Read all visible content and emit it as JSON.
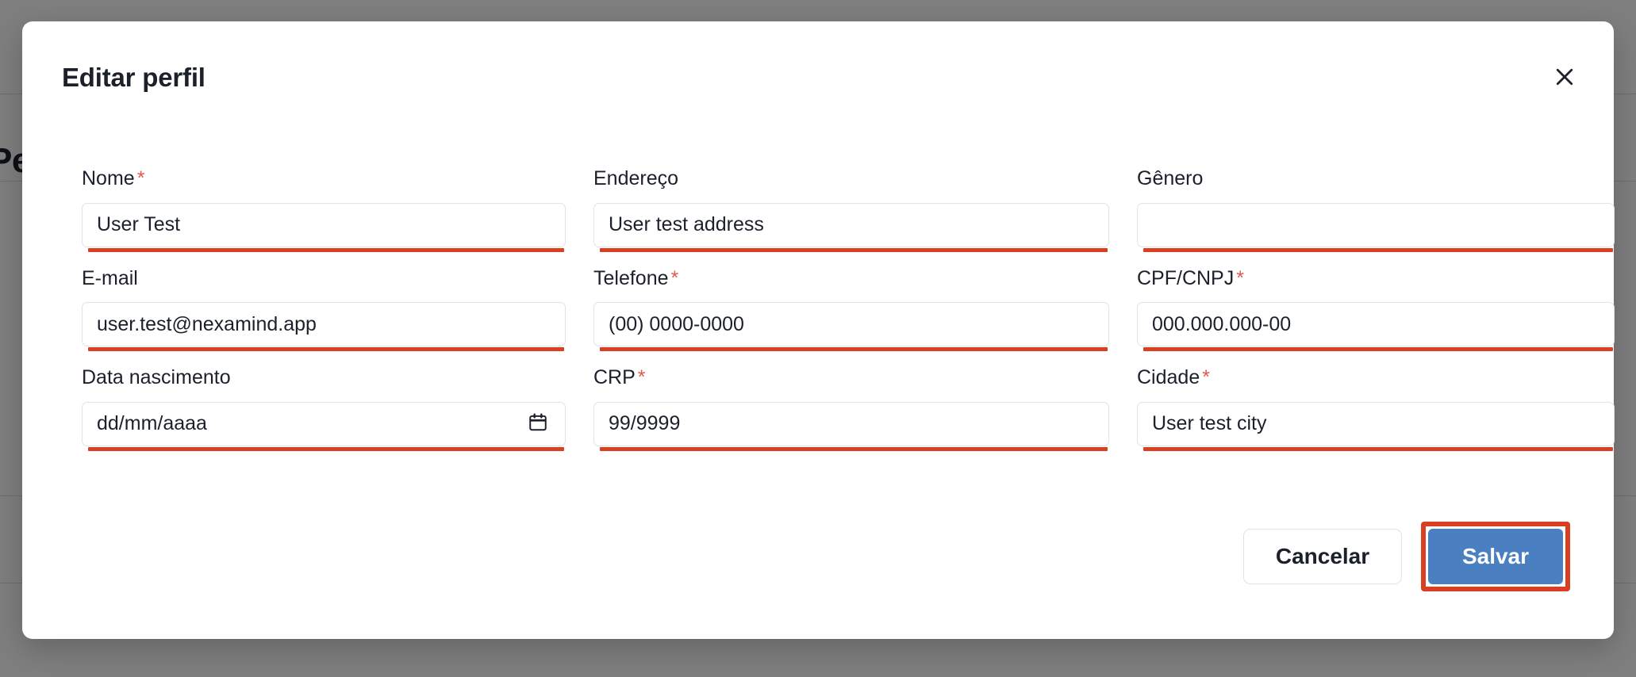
{
  "background": {
    "heading_text": "Pe"
  },
  "modal": {
    "title": "Editar perfil",
    "close_icon": "close-icon",
    "required_marker": "*",
    "fields": [
      {
        "key": "nome",
        "label": "Nome",
        "required": true,
        "value": "User Test",
        "placeholder": "",
        "type": "text"
      },
      {
        "key": "endereco",
        "label": "Endereço",
        "required": false,
        "value": "User test address",
        "placeholder": "",
        "type": "text"
      },
      {
        "key": "genero",
        "label": "Gênero",
        "required": false,
        "value": "",
        "placeholder": "",
        "type": "text"
      },
      {
        "key": "email",
        "label": "E-mail",
        "required": false,
        "value": "user.test@nexamind.app",
        "placeholder": "",
        "type": "text"
      },
      {
        "key": "telefone",
        "label": "Telefone",
        "required": true,
        "value": "",
        "placeholder": "(00) 0000-0000",
        "type": "text"
      },
      {
        "key": "cpf_cnpj",
        "label": "CPF/CNPJ",
        "required": true,
        "value": "",
        "placeholder": "000.000.000-00",
        "type": "text"
      },
      {
        "key": "data_nascimento",
        "label": "Data nascimento",
        "required": false,
        "value": "",
        "placeholder": "dd/mm/aaaa",
        "type": "date",
        "icon": "calendar-icon"
      },
      {
        "key": "crp",
        "label": "CRP",
        "required": true,
        "value": "",
        "placeholder": "99/9999",
        "type": "text"
      },
      {
        "key": "cidade",
        "label": "Cidade",
        "required": true,
        "value": "User test city",
        "placeholder": "",
        "type": "text"
      }
    ],
    "footer": {
      "cancel_label": "Cancelar",
      "save_label": "Salvar"
    }
  },
  "colors": {
    "accent_underline": "#d93f22",
    "save_button_bg": "#4a7fc1",
    "required_asterisk": "#e05a50",
    "text": "#1b202b",
    "input_border": "#dfe3e8",
    "scrim": "rgba(0,0,0,0.5)"
  }
}
